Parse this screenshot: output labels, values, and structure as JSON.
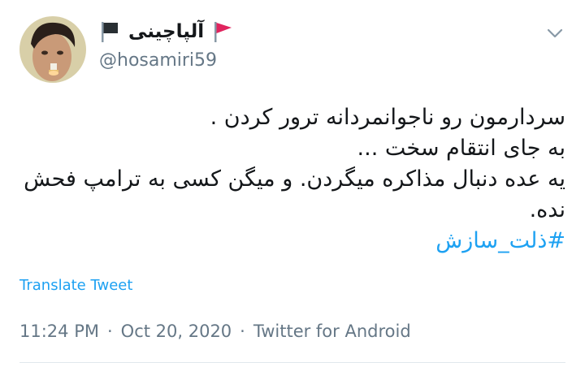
{
  "user": {
    "display_name": "آلپاچینی",
    "handle": "@hosamiri59"
  },
  "tweet": {
    "lines": [
      "سردارمون رو ناجوانمردانه ترور کردن .",
      "به جای انتقام سخت ...",
      "یه عده دنبال مذاکره میگردن. و میگن کسی به ترامپ فحش",
      "نده."
    ],
    "hashtag": "#ذلت_سازش"
  },
  "translate_label": "Translate Tweet",
  "meta": {
    "time": "11:24 PM",
    "sep1": "·",
    "date": "Oct 20, 2020",
    "sep2": "·",
    "source": "Twitter for Android"
  },
  "colors": {
    "link": "#1da1f2",
    "muted": "#657786",
    "text": "#14171a",
    "flag_red": "#e0245e",
    "flag_black": "#292f33"
  },
  "icons": {
    "caret": "chevron-down-icon",
    "flag_left": "black-flag-icon",
    "flag_right": "red-flag-icon"
  }
}
